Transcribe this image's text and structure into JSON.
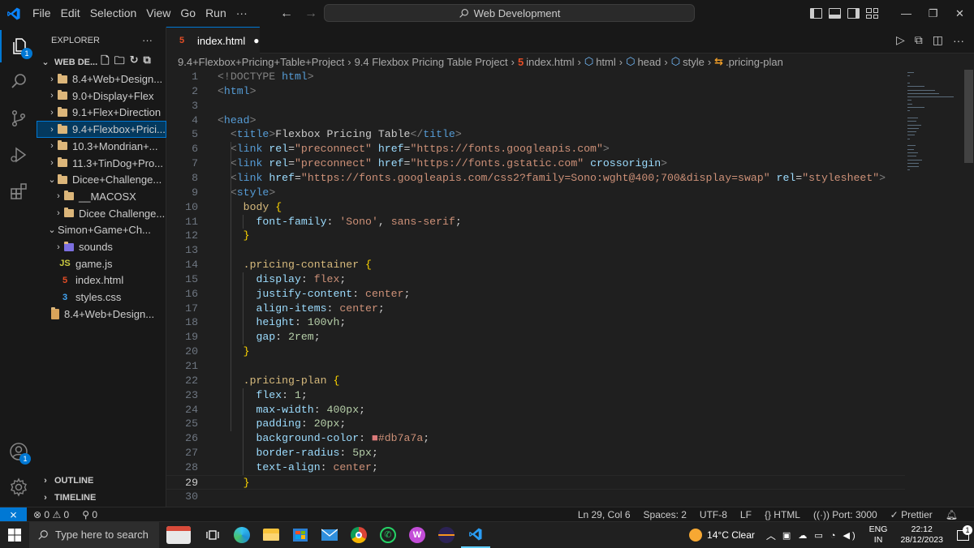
{
  "titlebar": {
    "menus": [
      "File",
      "Edit",
      "Selection",
      "View",
      "Go",
      "Run",
      "···"
    ],
    "search_text": "Web Development"
  },
  "activity": {
    "explorer_badge": "1",
    "accounts_badge": "1"
  },
  "sidebar": {
    "title": "EXPLORER",
    "more": "···",
    "workspace": "WEB DE...",
    "items": [
      {
        "label": "8.4+Web+Design...",
        "type": "folder",
        "chevron": "›",
        "indent": 0
      },
      {
        "label": "9.0+Display+Flex",
        "type": "folder",
        "chevron": "›",
        "indent": 0
      },
      {
        "label": "9.1+Flex+Direction",
        "type": "folder",
        "chevron": "›",
        "indent": 0
      },
      {
        "label": "9.4+Flexbox+Prici...",
        "type": "folder",
        "chevron": "›",
        "indent": 0,
        "selected": true
      },
      {
        "label": "10.3+Mondrian+...",
        "type": "folder",
        "chevron": "›",
        "indent": 0
      },
      {
        "label": "11.3+TinDog+Pro...",
        "type": "folder",
        "chevron": "›",
        "indent": 0
      },
      {
        "label": "Dicee+Challenge...",
        "type": "folder",
        "chevron": "⌄",
        "indent": 0
      },
      {
        "label": "__MACOSX",
        "type": "folder",
        "chevron": "›",
        "indent": 1
      },
      {
        "label": "Dicee Challenge...",
        "type": "folder",
        "chevron": "›",
        "indent": 1
      },
      {
        "label": "Simon+Game+Ch...",
        "type": "nofolder",
        "chevron": "⌄",
        "indent": 0
      },
      {
        "label": "sounds",
        "type": "sounds",
        "chevron": "›",
        "indent": 1
      },
      {
        "label": "game.js",
        "type": "js",
        "icon_text": "JS",
        "chevron": "",
        "indent": 1
      },
      {
        "label": "index.html",
        "type": "html",
        "icon_text": "5",
        "chevron": "",
        "indent": 1
      },
      {
        "label": "styles.css",
        "type": "css",
        "icon_text": "3",
        "chevron": "",
        "indent": 1
      },
      {
        "label": "8.4+Web+Design...",
        "type": "zip",
        "chevron": "",
        "indent": 0
      }
    ],
    "outline": "OUTLINE",
    "timeline": "TIMELINE"
  },
  "tab": {
    "label": "index.html",
    "dirty": "●"
  },
  "breadcrumb": [
    "9.4+Flexbox+Pricing+Table+Project",
    "9.4 Flexbox Pricing Table Project",
    "index.html",
    "html",
    "head",
    "style",
    ".pricing-plan"
  ],
  "editor": {
    "current_line": 29,
    "lines": [
      [
        [
          "<!DOCTYPE ",
          "#808080"
        ],
        [
          "html",
          "#569cd6"
        ],
        [
          ">",
          "#808080"
        ]
      ],
      [
        [
          "<",
          "#808080"
        ],
        [
          "html",
          "#569cd6"
        ],
        [
          ">",
          "#808080"
        ]
      ],
      [],
      [
        [
          "<",
          "#808080"
        ],
        [
          "head",
          "#569cd6"
        ],
        [
          ">",
          "#808080"
        ]
      ],
      [
        [
          "  <",
          "#808080"
        ],
        [
          "title",
          "#569cd6"
        ],
        [
          ">",
          "#808080"
        ],
        [
          "Flexbox Pricing Table",
          "#cccccc"
        ],
        [
          "</",
          "#808080"
        ],
        [
          "title",
          "#569cd6"
        ],
        [
          ">",
          "#808080"
        ]
      ],
      [
        [
          "  <",
          "#808080"
        ],
        [
          "link ",
          "#569cd6"
        ],
        [
          "rel",
          "#9cdcfe"
        ],
        [
          "=",
          "#cccccc"
        ],
        [
          "\"preconnect\"",
          "#ce9178"
        ],
        [
          " href",
          "#9cdcfe"
        ],
        [
          "=",
          "#cccccc"
        ],
        [
          "\"https://fonts.googleapis.com\"",
          "#ce9178"
        ],
        [
          ">",
          "#808080"
        ]
      ],
      [
        [
          "  <",
          "#808080"
        ],
        [
          "link ",
          "#569cd6"
        ],
        [
          "rel",
          "#9cdcfe"
        ],
        [
          "=",
          "#cccccc"
        ],
        [
          "\"preconnect\"",
          "#ce9178"
        ],
        [
          " href",
          "#9cdcfe"
        ],
        [
          "=",
          "#cccccc"
        ],
        [
          "\"https://fonts.gstatic.com\"",
          "#ce9178"
        ],
        [
          " crossorigin",
          "#9cdcfe"
        ],
        [
          ">",
          "#808080"
        ]
      ],
      [
        [
          "  <",
          "#808080"
        ],
        [
          "link ",
          "#569cd6"
        ],
        [
          "href",
          "#9cdcfe"
        ],
        [
          "=",
          "#cccccc"
        ],
        [
          "\"https://fonts.googleapis.com/css2?family=Sono:wght@400;700&display=swap\"",
          "#ce9178"
        ],
        [
          " rel",
          "#9cdcfe"
        ],
        [
          "=",
          "#cccccc"
        ],
        [
          "\"stylesheet\"",
          "#ce9178"
        ],
        [
          ">",
          "#808080"
        ]
      ],
      [
        [
          "  <",
          "#808080"
        ],
        [
          "style",
          "#569cd6"
        ],
        [
          ">",
          "#808080"
        ]
      ],
      [
        [
          "    body ",
          "#d7ba7d"
        ],
        [
          "{",
          "#ffd700"
        ]
      ],
      [
        [
          "      font-family",
          "#9cdcfe"
        ],
        [
          ": ",
          "#cccccc"
        ],
        [
          "'Sono'",
          "#ce9178"
        ],
        [
          ", ",
          "#cccccc"
        ],
        [
          "sans-serif",
          "#ce9178"
        ],
        [
          ";",
          "#cccccc"
        ]
      ],
      [
        [
          "    }",
          "#ffd700"
        ]
      ],
      [],
      [
        [
          "    .pricing-container ",
          "#d7ba7d"
        ],
        [
          "{",
          "#ffd700"
        ]
      ],
      [
        [
          "      display",
          "#9cdcfe"
        ],
        [
          ": ",
          "#cccccc"
        ],
        [
          "flex",
          "#ce9178"
        ],
        [
          ";",
          "#cccccc"
        ]
      ],
      [
        [
          "      justify-content",
          "#9cdcfe"
        ],
        [
          ": ",
          "#cccccc"
        ],
        [
          "center",
          "#ce9178"
        ],
        [
          ";",
          "#cccccc"
        ]
      ],
      [
        [
          "      align-items",
          "#9cdcfe"
        ],
        [
          ": ",
          "#cccccc"
        ],
        [
          "center",
          "#ce9178"
        ],
        [
          ";",
          "#cccccc"
        ]
      ],
      [
        [
          "      height",
          "#9cdcfe"
        ],
        [
          ": ",
          "#cccccc"
        ],
        [
          "100vh",
          "#b5cea8"
        ],
        [
          ";",
          "#cccccc"
        ]
      ],
      [
        [
          "      gap",
          "#9cdcfe"
        ],
        [
          ": ",
          "#cccccc"
        ],
        [
          "2rem",
          "#b5cea8"
        ],
        [
          ";",
          "#cccccc"
        ]
      ],
      [
        [
          "    }",
          "#ffd700"
        ]
      ],
      [],
      [
        [
          "    .pricing-plan ",
          "#d7ba7d"
        ],
        [
          "{",
          "#ffd700"
        ]
      ],
      [
        [
          "      flex",
          "#9cdcfe"
        ],
        [
          ": ",
          "#cccccc"
        ],
        [
          "1",
          "#b5cea8"
        ],
        [
          ";",
          "#cccccc"
        ]
      ],
      [
        [
          "      max-width",
          "#9cdcfe"
        ],
        [
          ": ",
          "#cccccc"
        ],
        [
          "400px",
          "#b5cea8"
        ],
        [
          ";",
          "#cccccc"
        ]
      ],
      [
        [
          "      padding",
          "#9cdcfe"
        ],
        [
          ": ",
          "#cccccc"
        ],
        [
          "20px",
          "#b5cea8"
        ],
        [
          ";",
          "#cccccc"
        ]
      ],
      [
        [
          "      background-color",
          "#9cdcfe"
        ],
        [
          ": ",
          "#cccccc"
        ],
        [
          "■",
          "#db7a7a"
        ],
        [
          "#db7a7a",
          "#ce9178"
        ],
        [
          ";",
          "#cccccc"
        ]
      ],
      [
        [
          "      border-radius",
          "#9cdcfe"
        ],
        [
          ": ",
          "#cccccc"
        ],
        [
          "5px",
          "#b5cea8"
        ],
        [
          ";",
          "#cccccc"
        ]
      ],
      [
        [
          "      text-align",
          "#9cdcfe"
        ],
        [
          ": ",
          "#cccccc"
        ],
        [
          "center",
          "#ce9178"
        ],
        [
          ";",
          "#cccccc"
        ]
      ],
      [
        [
          "    }",
          "#ffd700"
        ]
      ],
      []
    ]
  },
  "statusbar": {
    "problems_errors": "0",
    "problems_warnings": "0",
    "ports": "0",
    "position": "Ln 29, Col 6",
    "spaces": "Spaces: 2",
    "encoding": "UTF-8",
    "eol": "LF",
    "language": "HTML",
    "port": "Port: 3000",
    "prettier": "Prettier"
  },
  "taskbar": {
    "search_placeholder": "Type here to search",
    "weather": "14°C  Clear",
    "lang_top": "ENG",
    "lang_bottom": "IN",
    "time": "22:12",
    "date": "28/12/2023",
    "notif_count": "1"
  },
  "colors": {
    "accent": "#0078d4",
    "folder": "#dcb67a",
    "html_icon": "#e44d26",
    "css_icon": "#42a5f5",
    "js_icon": "#cbcb41"
  }
}
